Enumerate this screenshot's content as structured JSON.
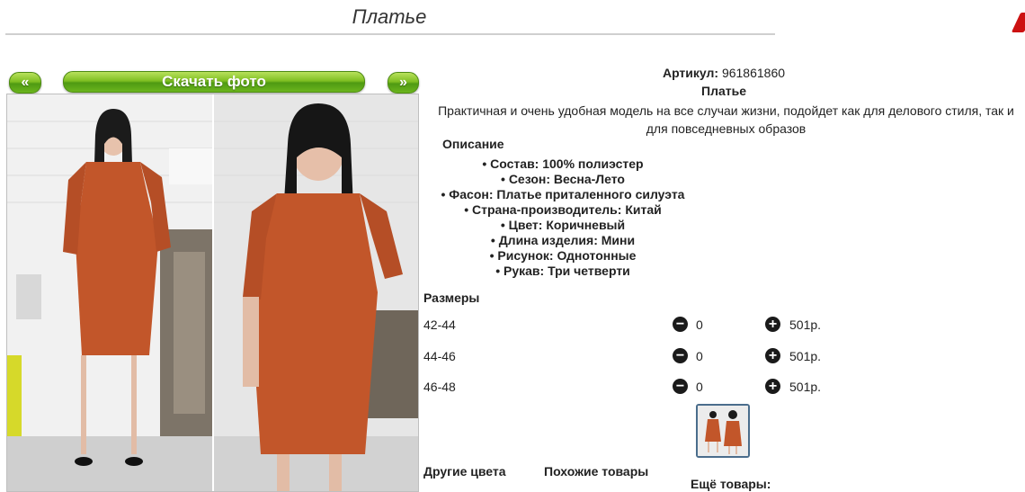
{
  "page": {
    "title": "Платье"
  },
  "gallery": {
    "prev_label": "«",
    "download_label": "Скачать фото",
    "next_label": "»"
  },
  "product": {
    "article_label": "Артикул:",
    "article_value": "961861860",
    "name": "Платье",
    "description": "Практичная и очень удобная модель на все случаи жизни, подойдет как для делового стиля, так и для повседневных образов",
    "description_heading": "Описание",
    "specs": [
      "• Состав: 100% полиэстер",
      "• Сезон: Весна-Лето",
      "• Фасон: Платье приталенного силуэта",
      "• Страна-производитель: Китай",
      "• Цвет: Коричневый",
      "• Длина изделия: Мини",
      "• Рисунок: Однотонные",
      "• Рукав: Три четверти"
    ]
  },
  "sizes": {
    "heading": "Размеры",
    "rows": [
      {
        "size": "42-44",
        "qty": "0",
        "price": "501р."
      },
      {
        "size": "44-46",
        "qty": "0",
        "price": "501р."
      },
      {
        "size": "46-48",
        "qty": "0",
        "price": "501р."
      }
    ],
    "minus_icon": "−",
    "plus_icon": "+"
  },
  "footer": {
    "other_colors": "Другие цвета",
    "similar": "Похожие товары",
    "more": "Ещё товары:"
  },
  "colors": {
    "accent_green": "#6bb51d",
    "dress": "#c2562a",
    "mark": "#cc1111"
  }
}
